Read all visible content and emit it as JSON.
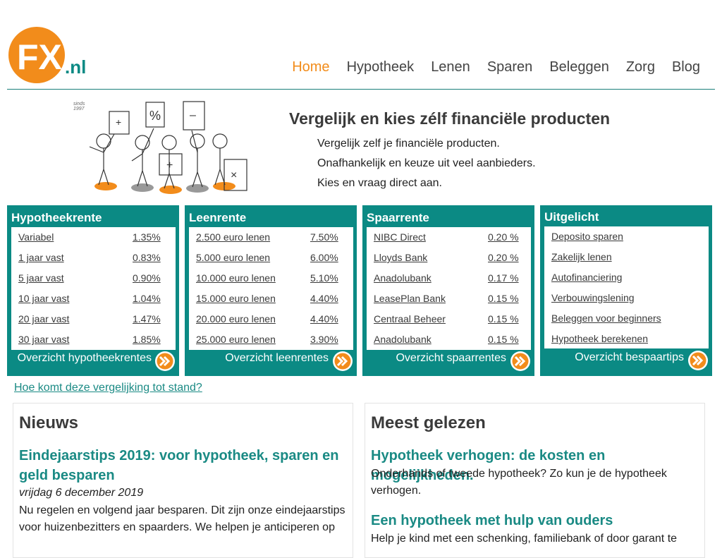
{
  "header": {
    "logo_text": "FX",
    "logo_suffix": ".nl",
    "logo_tagline": "sinds 1997",
    "nav": [
      {
        "label": "Home",
        "active": true
      },
      {
        "label": "Hypotheek",
        "active": false
      },
      {
        "label": "Lenen",
        "active": false
      },
      {
        "label": "Sparen",
        "active": false
      },
      {
        "label": "Beleggen",
        "active": false
      },
      {
        "label": "Zorg",
        "active": false
      },
      {
        "label": "Blog",
        "active": false
      }
    ]
  },
  "hero": {
    "title": "Vergelijk en kies zélf financiële producten",
    "lines": [
      "Vergelijk zelf je financiële producten.",
      "Onafhankelijk en keuze uit veel aanbieders.",
      "Kies en vraag direct aan."
    ]
  },
  "panels": [
    {
      "title": "Hypotheekrente",
      "rows": [
        {
          "name": "Variabel",
          "value": "1.35%"
        },
        {
          "name": "1 jaar vast",
          "value": "0.83%"
        },
        {
          "name": "5 jaar vast",
          "value": "0.90%"
        },
        {
          "name": "10 jaar vast",
          "value": "1.04%"
        },
        {
          "name": "20 jaar vast",
          "value": "1.47%"
        },
        {
          "name": "30 jaar vast",
          "value": "1.85%"
        }
      ],
      "overview": "Overzicht hypotheekrentes"
    },
    {
      "title": "Leenrente",
      "rows": [
        {
          "name": "2.500 euro lenen",
          "value": "7.50%"
        },
        {
          "name": "5.000 euro lenen",
          "value": "6.00%"
        },
        {
          "name": "10.000 euro lenen",
          "value": "5.10%"
        },
        {
          "name": "15.000 euro lenen",
          "value": "4.40%"
        },
        {
          "name": "20.000 euro lenen",
          "value": "4.40%"
        },
        {
          "name": "25.000 euro lenen",
          "value": "3.90%"
        }
      ],
      "overview": "Overzicht leenrentes"
    },
    {
      "title": "Spaarrente",
      "rows": [
        {
          "name": "NIBC Direct",
          "value": "0.20 %"
        },
        {
          "name": "Lloyds Bank",
          "value": "0.20 %"
        },
        {
          "name": "Anadolubank",
          "value": "0.17 %"
        },
        {
          "name": "LeasePlan Bank",
          "value": "0.15 %"
        },
        {
          "name": "Centraal Beheer",
          "value": "0.15 %"
        },
        {
          "name": "Anadolubank",
          "value": "0.15 %"
        }
      ],
      "overview": "Overzicht spaarrentes"
    },
    {
      "title": "Uitgelicht",
      "rows": [
        {
          "name": "Deposito sparen",
          "value": ""
        },
        {
          "name": "Zakelijk lenen",
          "value": ""
        },
        {
          "name": "Autofinanciering",
          "value": ""
        },
        {
          "name": "Verbouwingslening",
          "value": ""
        },
        {
          "name": "Beleggen voor beginners",
          "value": ""
        },
        {
          "name": "Hypotheek berekenen",
          "value": ""
        }
      ],
      "overview": "Overzicht bespaartips"
    }
  ],
  "how_link": "Hoe komt deze vergelijking tot stand?",
  "news": {
    "heading": "Nieuws",
    "article_title": "Eindejaarstips 2019: voor hypotheek, sparen en geld besparen",
    "date": "vrijdag 6 december 2019",
    "text": "Nu regelen en volgend jaar besparen. Dit zijn onze eindejaarstips voor huizenbezitters en spaarders. We helpen je anticiperen op"
  },
  "most_read": {
    "heading": "Meest gelezen",
    "items": [
      {
        "title": "Hypotheek verhogen: de kosten en mogelijkheden.",
        "text": "Onderhands of tweede hypotheek? Zo kun je de hypotheek verhogen."
      },
      {
        "title": "Een hypotheek met hulp van ouders",
        "text": "Help je kind met een schenking, familiebank of door garant te"
      }
    ]
  },
  "colors": {
    "teal": "#0b8a84",
    "orange": "#f28c1b",
    "link": "#1a8a84"
  }
}
